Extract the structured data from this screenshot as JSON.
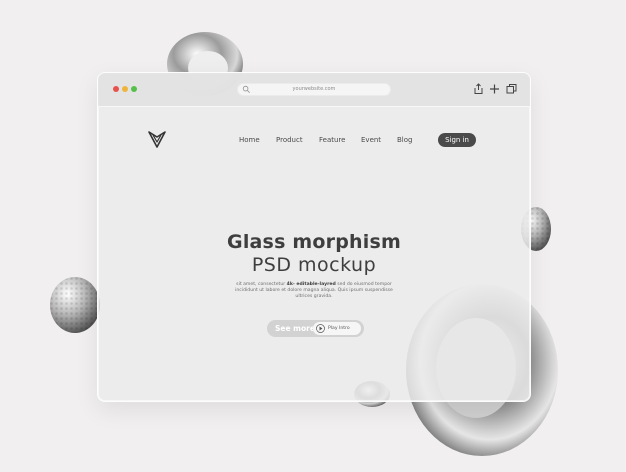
{
  "browser": {
    "url": "yourwebsite.com"
  },
  "nav": {
    "links": [
      "Home",
      "Product",
      "Feature",
      "Event",
      "Blog"
    ],
    "signin_label": "Sign in"
  },
  "hero": {
    "title_line1": "Glass morphism",
    "title_line2": "PSD mockup",
    "desc_pre": "sit amet, consectetur",
    "desc_bold": "4k- editable-layred",
    "desc_post": "sed do eiusmod tempor incididunt ut labore et dolore magna aliqua. Quis ipsum suspendisse ultrices gravida.",
    "see_more_label": "See more",
    "play_label": "Play Intro"
  },
  "colors": {
    "background": "#f1efef",
    "dot_red": "#e8524c",
    "dot_yellow": "#eeb53c",
    "dot_green": "#56c04a",
    "accent_dark": "#4a4a4a"
  }
}
